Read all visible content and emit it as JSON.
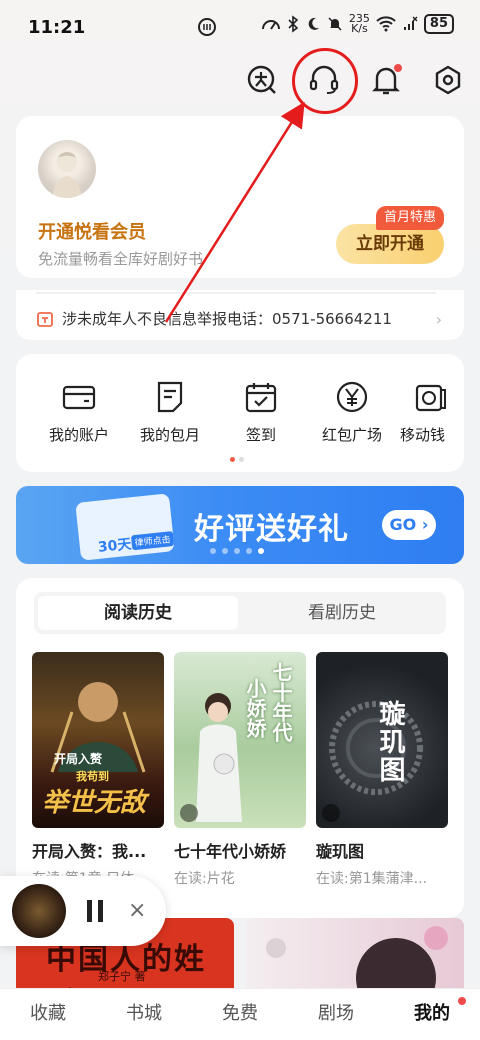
{
  "status": {
    "time": "11:21",
    "speed": "235\nK/s",
    "speed_top": "235",
    "speed_bottom": "K/s",
    "battery": "85"
  },
  "vip": {
    "title": "开通悦看会员",
    "subtitle": "免流量畅看全库好剧好书",
    "badge": "首月特惠",
    "button": "立即开通"
  },
  "notice": {
    "text": "涉未成年人不良信息举报电话：0571-56664211"
  },
  "services": [
    {
      "label": "我的账户"
    },
    {
      "label": "我的包月"
    },
    {
      "label": "签到"
    },
    {
      "label": "红包广场"
    },
    {
      "label": "移动钱"
    }
  ],
  "banner": {
    "title": "好评送好礼",
    "go": "GO",
    "ticket_days": "30天",
    "ticket_sub": "律师点击"
  },
  "history": {
    "tabs": [
      "阅读历史",
      "看剧历史"
    ],
    "books": [
      {
        "name": "开局入赘：我...",
        "progress": "在读:第1章 只体",
        "cover_text_a": "开局入赘",
        "cover_text_b": "我苟到",
        "cover_text_c": "举世无敌"
      },
      {
        "name": "七十年代小娇娇",
        "progress": "在读:片花",
        "cover_text_a": "七十年代",
        "cover_text_b": "小娇娇"
      },
      {
        "name": "璇玑图",
        "progress": "在读:第1集蒲津...",
        "cover_text_a": "璇玑图"
      }
    ]
  },
  "bottom_covers": {
    "left_text": "中国人的姓氏",
    "left_author": "郑子宁 著"
  },
  "nav": [
    "收藏",
    "书城",
    "免费",
    "剧场",
    "我的"
  ]
}
